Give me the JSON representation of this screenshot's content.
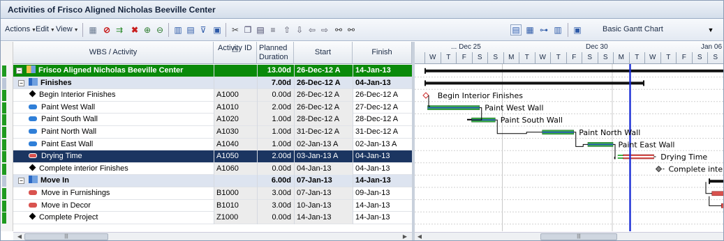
{
  "window": {
    "title": "Activities of Frisco Aligned Nicholas Beeville Center"
  },
  "toolbar": {
    "actions": "Actions",
    "edit": "Edit",
    "view": "View",
    "layout_name": "Basic Gantt Chart"
  },
  "columns": {
    "wbs": "WBS / Activity",
    "id": "Activity ID",
    "sort_indicator": "△",
    "dur1": "Planned",
    "dur2": "Duration",
    "start": "Start",
    "finish": "Finish"
  },
  "rows": [
    {
      "kind": "project",
      "name": "Frisco Aligned Nicholas Beeville Center",
      "id": "",
      "dur": "13.00d",
      "start": "26-Dec-12 A",
      "finish": "14-Jan-13"
    },
    {
      "kind": "wbs",
      "name": "Finishes",
      "id": "",
      "dur": "7.00d",
      "start": "26-Dec-12 A",
      "finish": "04-Jan-13"
    },
    {
      "kind": "milestone",
      "name": "Begin Interior Finishes",
      "id": "A1000",
      "dur": "0.00d",
      "start": "26-Dec-12 A",
      "finish": "26-Dec-12 A"
    },
    {
      "kind": "done",
      "name": "Paint West Wall",
      "id": "A1010",
      "dur": "2.00d",
      "start": "26-Dec-12 A",
      "finish": "27-Dec-12 A"
    },
    {
      "kind": "done",
      "name": "Paint South Wall",
      "id": "A1020",
      "dur": "1.00d",
      "start": "28-Dec-12 A",
      "finish": "28-Dec-12 A"
    },
    {
      "kind": "done",
      "name": "Paint North Wall",
      "id": "A1030",
      "dur": "1.00d",
      "start": "31-Dec-12 A",
      "finish": "31-Dec-12 A"
    },
    {
      "kind": "done",
      "name": "Paint East Wall",
      "id": "A1040",
      "dur": "1.00d",
      "start": "02-Jan-13 A",
      "finish": "02-Jan-13 A"
    },
    {
      "kind": "selected",
      "name": "Drying Time",
      "id": "A1050",
      "dur": "2.00d",
      "start": "03-Jan-13 A",
      "finish": "04-Jan-13"
    },
    {
      "kind": "milestone",
      "name": "Complete interior Finishes",
      "id": "A1060",
      "dur": "0.00d",
      "start": "04-Jan-13",
      "finish": "04-Jan-13"
    },
    {
      "kind": "wbs",
      "name": "Move In",
      "id": "",
      "dur": "6.00d",
      "start": "07-Jan-13",
      "finish": "14-Jan-13"
    },
    {
      "kind": "critical",
      "name": "Move in Furnishings",
      "id": "B1000",
      "dur": "3.00d",
      "start": "07-Jan-13",
      "finish": "09-Jan-13"
    },
    {
      "kind": "critical",
      "name": "Move in Decor",
      "id": "B1010",
      "dur": "3.00d",
      "start": "10-Jan-13",
      "finish": "14-Jan-13"
    },
    {
      "kind": "milestone",
      "name": "Complete Project",
      "id": "Z1000",
      "dur": "0.00d",
      "start": "14-Jan-13",
      "finish": "14-Jan-13"
    }
  ],
  "timescale": {
    "weeks": [
      "... Dec 25",
      "Dec 30",
      "Jan 06"
    ],
    "days": [
      "W",
      "T",
      "F",
      "S",
      "S",
      "M",
      "T",
      "W",
      "T",
      "F",
      "S",
      "S",
      "M",
      "T",
      "W",
      "T",
      "F",
      "S",
      "S",
      "M"
    ]
  },
  "gantt_labels": [
    "Begin Interior Finishes",
    "Paint West Wall",
    "Paint South Wall",
    "Paint North Wall",
    "Paint East Wall",
    "Drying Time",
    "Complete interior F"
  ],
  "colors": {
    "project_green": "#0a8a0a",
    "wbs_band": "#dde4f0",
    "selected": "#1b3561",
    "actual_green": "#3cb043",
    "remaining_red": "#d9534f",
    "data_date": "#1a2dd6",
    "done_blue": "#2f7fd8"
  }
}
